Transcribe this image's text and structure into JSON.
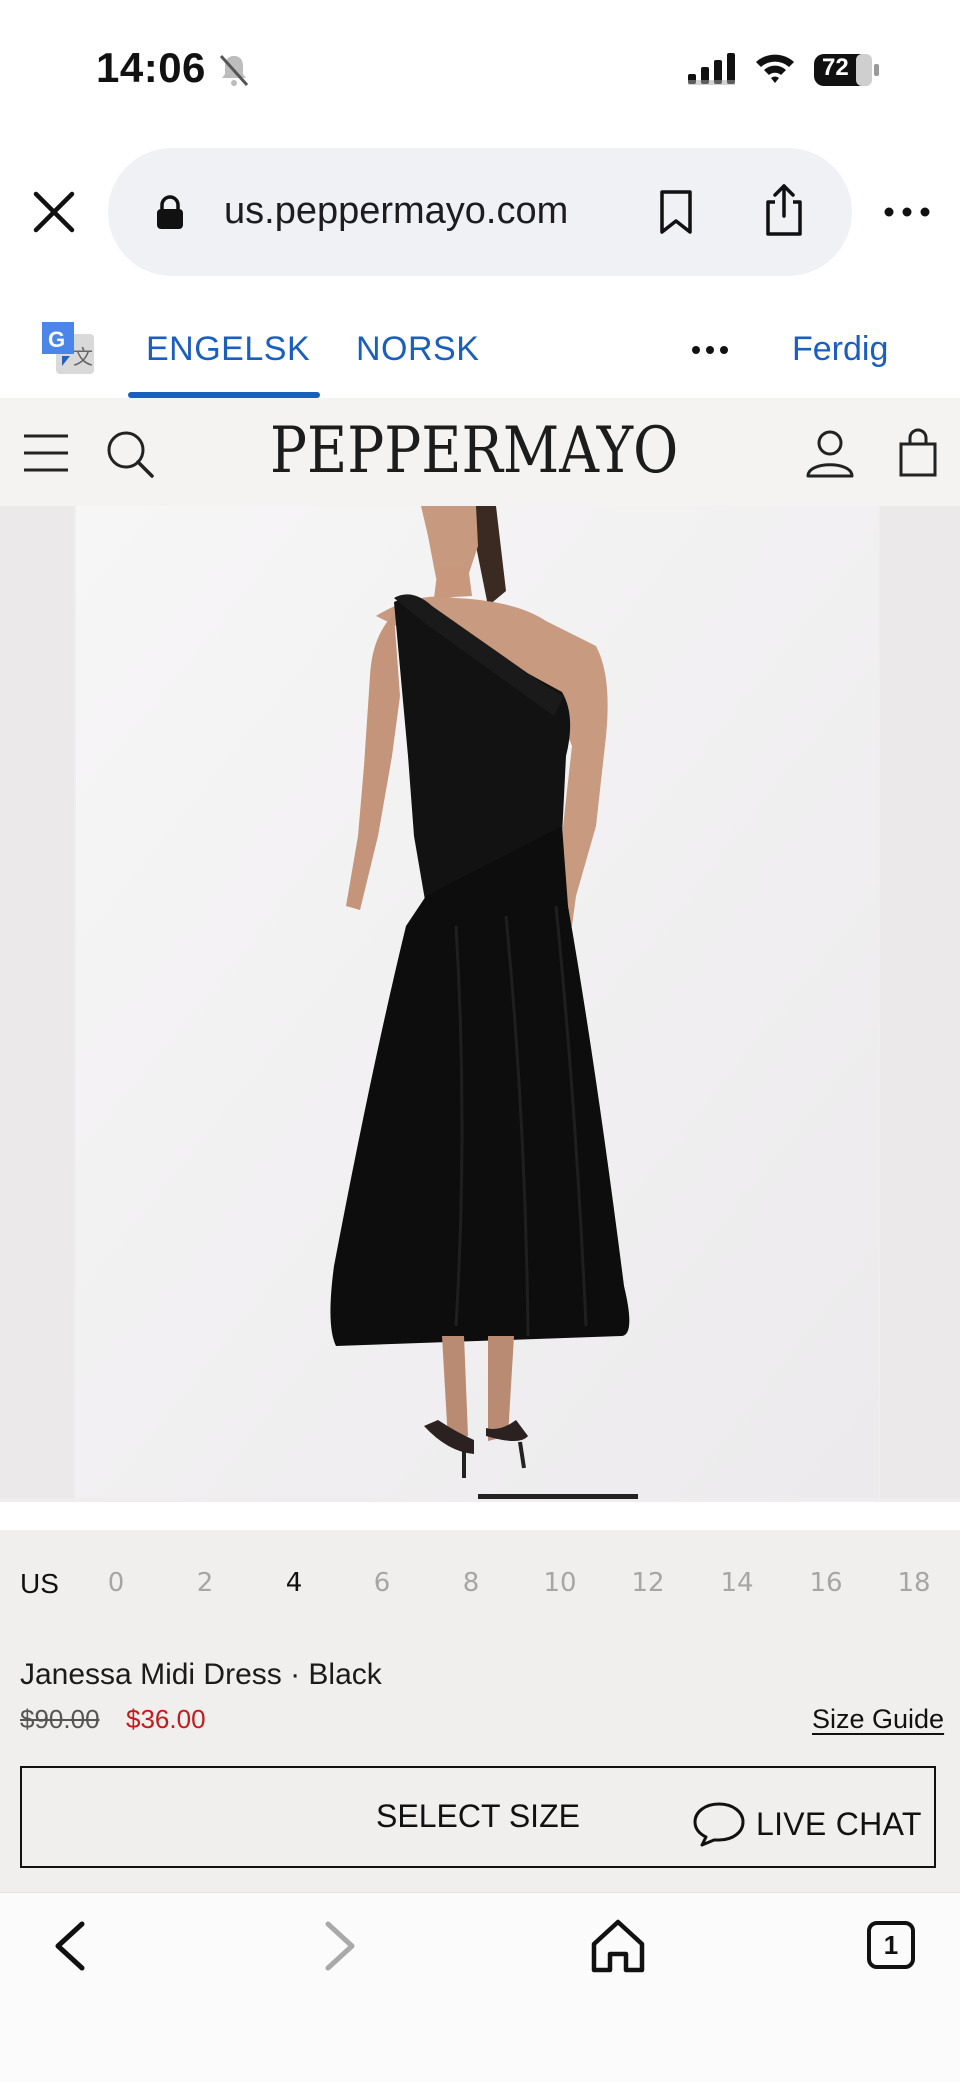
{
  "status_bar": {
    "time": "14:06",
    "battery": "72",
    "icons": [
      "bell-muted-icon",
      "cellular-signal-icon",
      "wifi-icon",
      "battery-icon"
    ]
  },
  "browser": {
    "url": "us.peppermayo.com",
    "icons": [
      "close-icon",
      "lock-icon",
      "bookmark-icon",
      "share-icon",
      "more-icon"
    ]
  },
  "translate": {
    "tabs": [
      "ENGELSK",
      "NORSK"
    ],
    "active_tab": "ENGELSK",
    "done_label": "Ferdig",
    "accent": "#1a5fbd"
  },
  "site": {
    "logo": "PEPPERMAYO",
    "icons": [
      "menu-icon",
      "search-icon",
      "account-icon",
      "bag-icon"
    ],
    "header_bg": "#f4f3f1"
  },
  "product": {
    "sizes": {
      "region": "US",
      "options": [
        "0",
        "2",
        "4",
        "6",
        "8",
        "10",
        "12",
        "14",
        "16",
        "18"
      ],
      "available": [
        "4"
      ]
    },
    "name": "Janessa Midi Dress · Black",
    "old_price": "$90.00",
    "price": "$36.00",
    "sale_color": "#c31b1b",
    "size_guide": "Size Guide",
    "select_size": "SELECT SIZE",
    "live_chat": "LIVE CHAT"
  },
  "toolbar": {
    "tab_count": "1",
    "icons": [
      "back-icon",
      "forward-icon",
      "home-icon",
      "tabs-icon"
    ]
  }
}
